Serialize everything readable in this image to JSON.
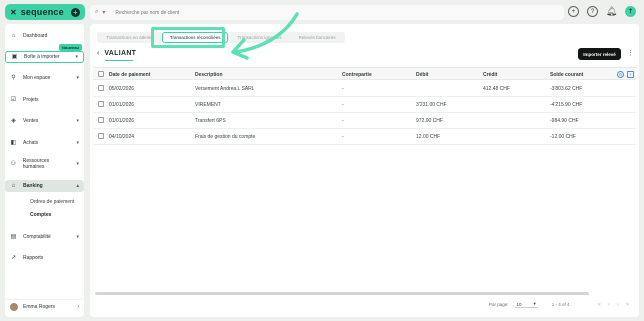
{
  "logo": {
    "mark": "✕",
    "text": "sequence",
    "plus": "+"
  },
  "search": {
    "placeholder": "Recherche par nom de client"
  },
  "sidebar": {
    "items": [
      {
        "label": "Dashboard",
        "icon": "home-icon"
      },
      {
        "label": "Boîte à importer",
        "icon": "inbox-icon",
        "badge": "Nouveau"
      },
      {
        "label": "Mon espace",
        "icon": "user-icon"
      },
      {
        "label": "Projets",
        "icon": "check-square-icon"
      },
      {
        "label": "Ventes",
        "icon": "tag-icon"
      },
      {
        "label": "Achats",
        "icon": "bag-icon"
      },
      {
        "label": "Ressources humaines",
        "icon": "people-icon"
      },
      {
        "label": "Banking",
        "icon": "bank-icon"
      },
      {
        "label": "Comptabilité",
        "icon": "ledger-icon"
      },
      {
        "label": "Rapports",
        "icon": "chart-icon"
      }
    ],
    "sub_items": [
      "Ordres de paiement",
      "Comptes"
    ],
    "user": "Emma Rogers"
  },
  "tabs": [
    "Transactions en attente",
    "Transactions réconciliées",
    "Transactions ignorées",
    "Relevés bancaires"
  ],
  "page": {
    "title": "VALIANT",
    "import_button": "Importer relevé"
  },
  "table": {
    "columns": [
      "Date de paiement",
      "Description",
      "Contrepartie",
      "Débit",
      "Crédit",
      "Solde courant"
    ],
    "rows": [
      {
        "date": "05/02/2026",
        "description": "Versement Andrea.L SARL",
        "counterparty": "-",
        "debit": "",
        "credit": "412.48 CHF",
        "balance": "-3'803.62 CHF"
      },
      {
        "date": "01/01/2026",
        "description": "VIREMENT",
        "counterparty": "-",
        "debit": "3'231.00 CHF",
        "credit": "",
        "balance": "-4'215.90 CHF"
      },
      {
        "date": "01/01/2026",
        "description": "Transfert 6PS",
        "counterparty": "-",
        "debit": "972.90 CHF",
        "credit": "",
        "balance": "-984.90 CHF"
      },
      {
        "date": "04/10/2024",
        "description": "Frais de gestion du compte",
        "counterparty": "-",
        "debit": "12.00 CHF",
        "credit": "",
        "balance": "-12.00 CHF"
      }
    ]
  },
  "footer": {
    "per_page_label": "Par page:",
    "per_page_value": "10",
    "range": "1 - 4 of 4"
  },
  "colors": {
    "accent": "#3fd1a6",
    "highlight": "#5ee0b6"
  }
}
